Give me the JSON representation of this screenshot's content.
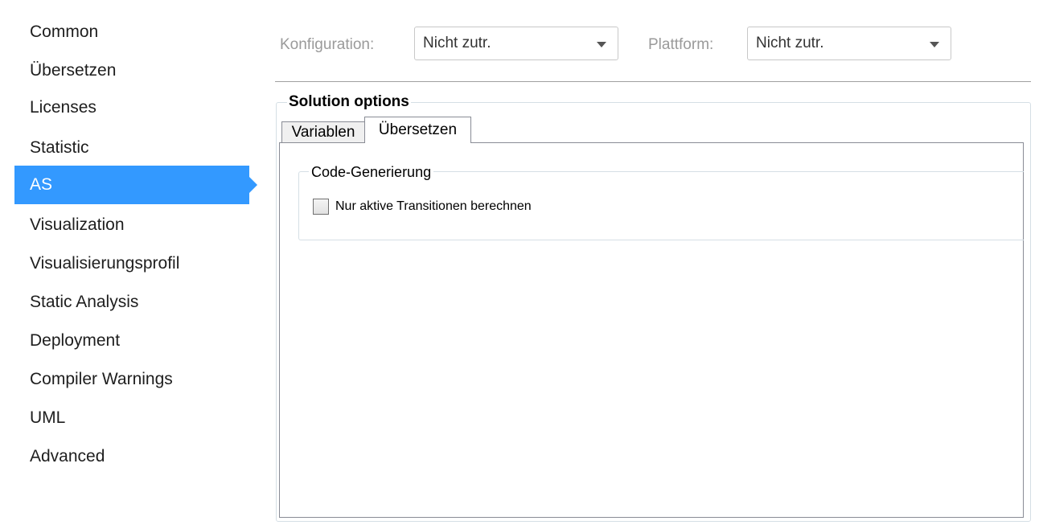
{
  "sidebar": {
    "items": [
      {
        "label": "Common"
      },
      {
        "label": "Übersetzen"
      },
      {
        "label": "Licenses"
      },
      {
        "label": "Statistic"
      },
      {
        "label": "AS",
        "selected": true
      },
      {
        "label": "Visualization"
      },
      {
        "label": "Visualisierungsprofil"
      },
      {
        "label": "Static Analysis"
      },
      {
        "label": "Deployment"
      },
      {
        "label": "Compiler Warnings"
      },
      {
        "label": "UML"
      },
      {
        "label": "Advanced"
      }
    ],
    "selected_color": "#3399ff"
  },
  "toolbar": {
    "configuration_label": "Konfiguration:",
    "configuration_value": "Nicht zutr.",
    "platform_label": "Plattform:",
    "platform_value": "Nicht zutr."
  },
  "solution_options": {
    "title": "Solution options",
    "tabs": [
      {
        "label": "Variablen",
        "active": false
      },
      {
        "label": "Übersetzen",
        "active": true
      }
    ],
    "code_generation": {
      "title": "Code-Generierung",
      "checkbox_label": "Nur aktive Transitionen berechnen",
      "checked": false
    }
  },
  "icons": {
    "dropdown": "chevron-down-icon"
  }
}
